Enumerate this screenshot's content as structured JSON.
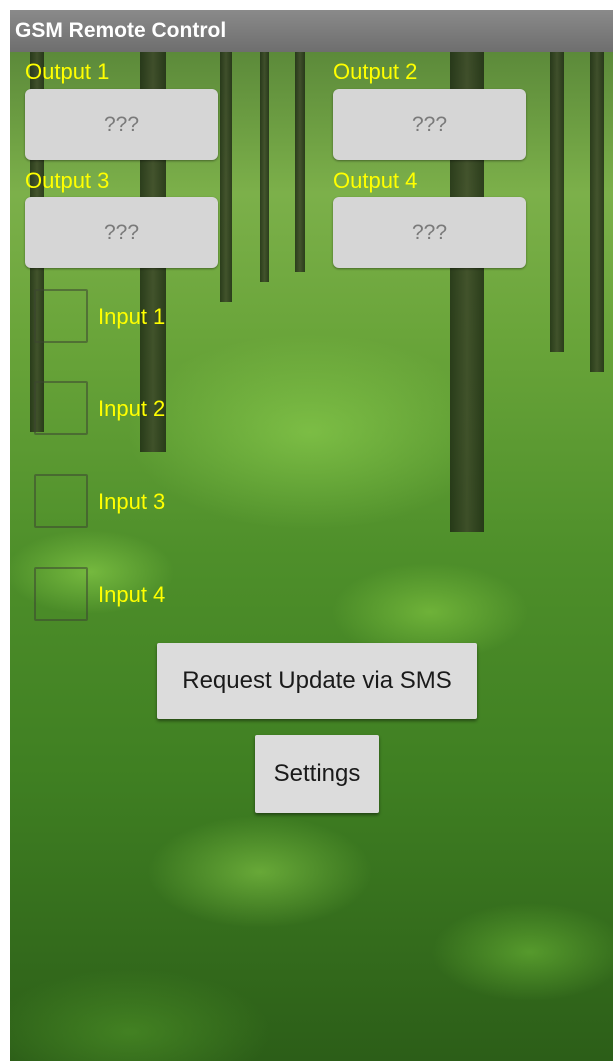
{
  "app": {
    "title": "GSM Remote Control"
  },
  "outputs": [
    {
      "label": "Output 1",
      "value": "???"
    },
    {
      "label": "Output 2",
      "value": "???"
    },
    {
      "label": "Output 3",
      "value": "???"
    },
    {
      "label": "Output 4",
      "value": "???"
    }
  ],
  "inputs": [
    {
      "label": "Input 1",
      "checked": false
    },
    {
      "label": "Input 2",
      "checked": false
    },
    {
      "label": "Input 3",
      "checked": false
    },
    {
      "label": "Input 4",
      "checked": false
    }
  ],
  "actions": {
    "request_update_label": "Request Update via SMS",
    "settings_label": "Settings"
  },
  "colors": {
    "label_text": "#ffff00",
    "titlebar": "#7a7a7a",
    "button_bg": "#d6d6d6"
  }
}
